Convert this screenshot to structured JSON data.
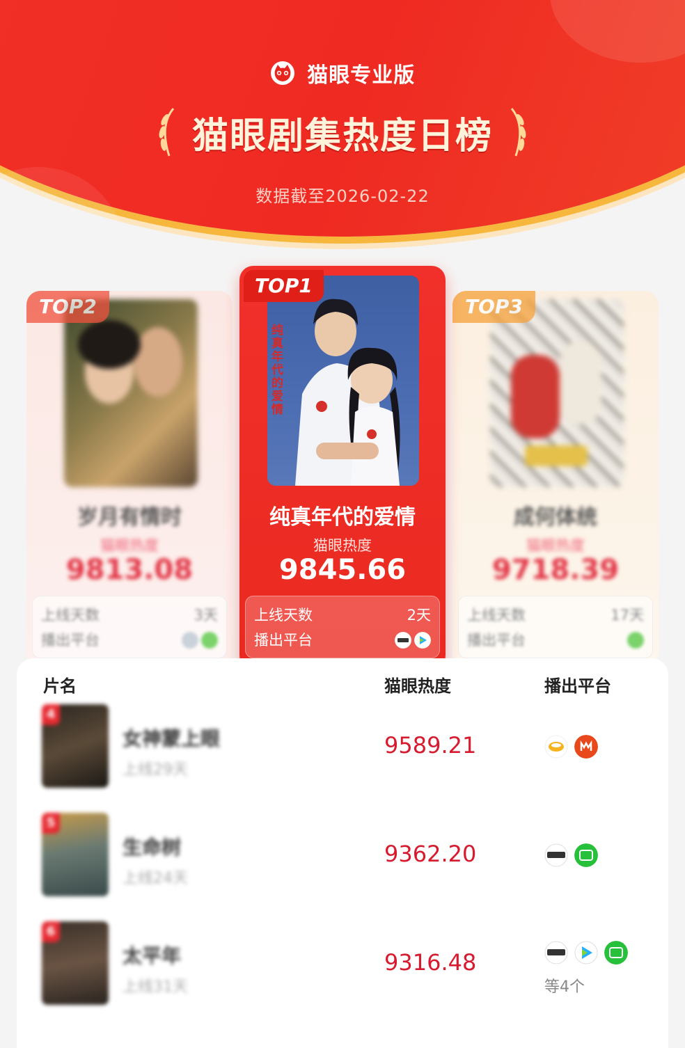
{
  "header": {
    "brand": "猫眼专业版",
    "title": "猫眼剧集热度日榜",
    "date": "数据截至2026-02-22"
  },
  "top3": [
    {
      "rank_label": "TOP1",
      "name": "纯真年代的爱情",
      "heat_label": "猫眼热度",
      "heat": "9845.66",
      "days_label": "上线天数",
      "days": "2天",
      "platform_label": "播出平台",
      "poster_text": "纯真年代的爱情"
    },
    {
      "rank_label": "TOP2",
      "name": "岁月有情时",
      "heat_label": "猫眼热度",
      "heat": "9813.08",
      "days_label": "上线天数",
      "days": "3天",
      "platform_label": "播出平台"
    },
    {
      "rank_label": "TOP3",
      "name": "成何体统",
      "heat_label": "猫眼热度",
      "heat": "9718.39",
      "days_label": "上线天数",
      "days": "17天",
      "platform_label": "播出平台"
    }
  ],
  "list": {
    "headers": {
      "name": "片名",
      "heat": "猫眼热度",
      "platform": "播出平台"
    },
    "rows": [
      {
        "rank": "4",
        "name": "女神蒙上眼",
        "days": "上线29天",
        "heat": "9589.21",
        "more": ""
      },
      {
        "rank": "5",
        "name": "生命树",
        "days": "上线24天",
        "heat": "9362.20",
        "more": ""
      },
      {
        "rank": "6",
        "name": "太平年",
        "days": "上线31天",
        "heat": "9316.48",
        "more": "等4个"
      }
    ]
  },
  "colors": {
    "brand_red": "#ef2a22",
    "heat_red": "#d71a2e",
    "gold": "#f6b73c"
  }
}
